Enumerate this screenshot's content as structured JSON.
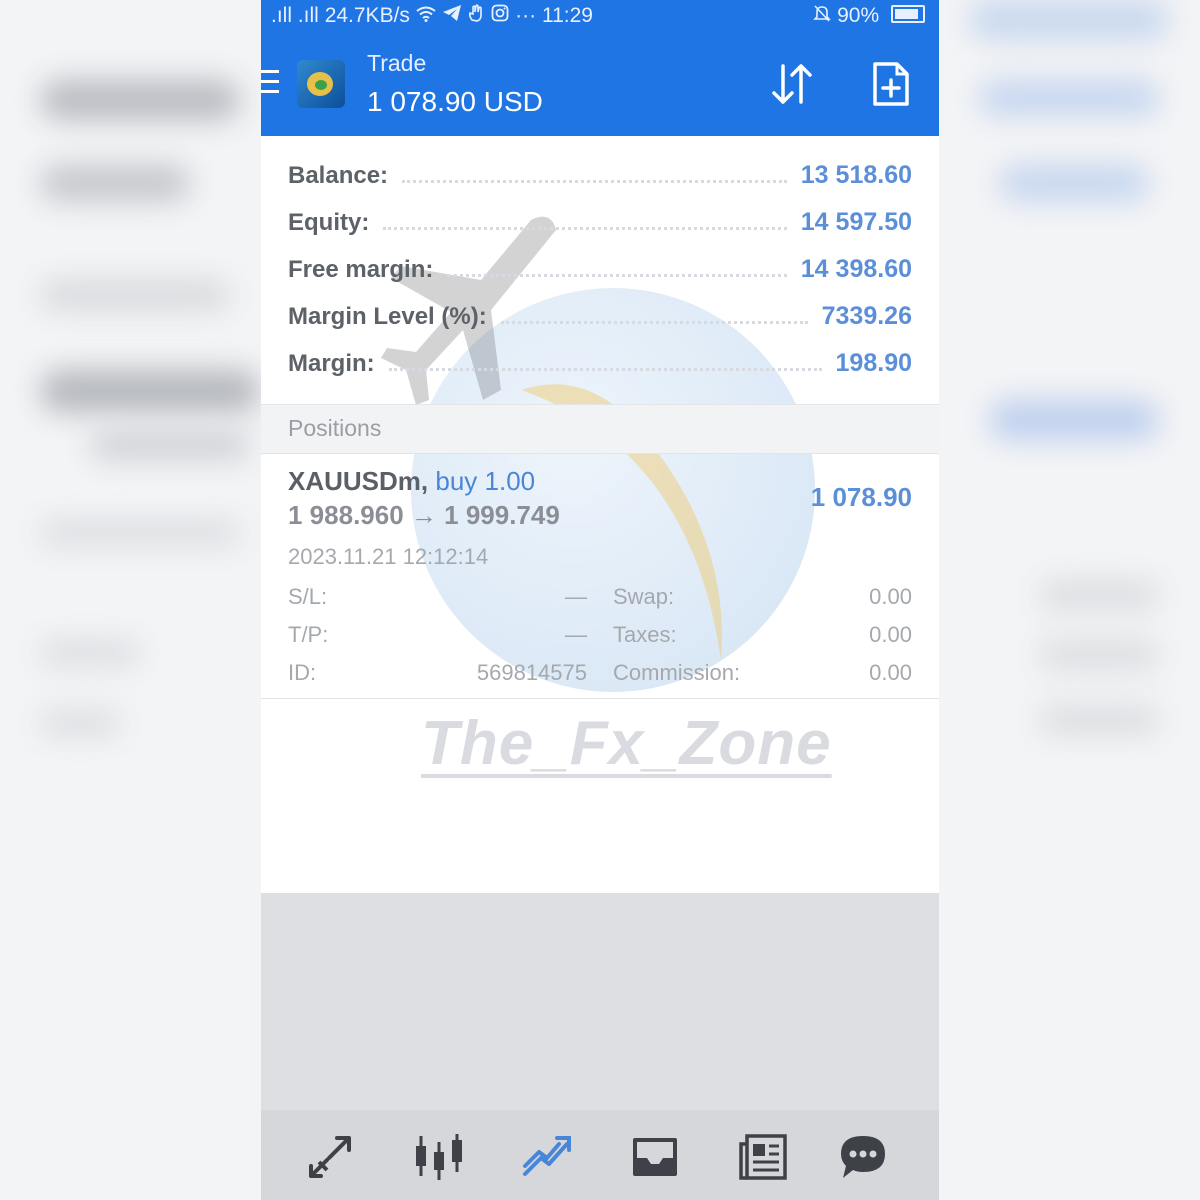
{
  "status_bar": {
    "signal": ".ıll .ıll",
    "speed": "24.7KB/s",
    "icons": [
      "wifi-icon",
      "telegram-icon",
      "hand-icon",
      "instagram-icon"
    ],
    "more": "···",
    "time": "11:29",
    "battery": "90%"
  },
  "app_bar": {
    "title": "Trade",
    "subtitle": "1 078.90 USD"
  },
  "account": [
    {
      "label": "Balance:",
      "value": "13 518.60"
    },
    {
      "label": "Equity:",
      "value": "14 597.50"
    },
    {
      "label": "Free margin:",
      "value": "14 398.60"
    },
    {
      "label": "Margin Level (%):",
      "value": "7339.26"
    },
    {
      "label": "Margin:",
      "value": "198.90"
    }
  ],
  "positions_header": "Positions",
  "position": {
    "symbol": "XAUUSDm,",
    "direction": "buy 1.00",
    "open_price": "1 988.960",
    "arrow": "→",
    "current_price": "1 999.749",
    "profit": "1 078.90",
    "time": "2023.11.21 12:12:14",
    "details": {
      "sl_label": "S/L:",
      "sl_value": "—",
      "tp_label": "T/P:",
      "tp_value": "—",
      "id_label": "ID:",
      "id_value": "569814575",
      "swap_label": "Swap:",
      "swap_value": "0.00",
      "taxes_label": "Taxes:",
      "taxes_value": "0.00",
      "commission_label": "Commission:",
      "commission_value": "0.00"
    }
  },
  "watermark": "The_Fx_Zone",
  "bottom_nav": [
    "quotes-icon",
    "chart-icon",
    "trade-icon",
    "history-icon",
    "news-icon",
    "chat-icon"
  ],
  "colors": {
    "primary": "#1f75e3",
    "value_blue": "#5b8fd8",
    "active_nav": "#4a86d8"
  }
}
